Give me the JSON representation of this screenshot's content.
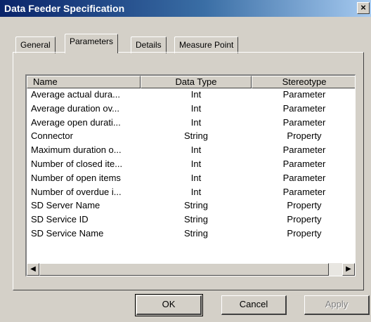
{
  "window": {
    "title": "Data Feeder Specification",
    "close_label": "×"
  },
  "tabs": [
    {
      "label": "General",
      "active": false
    },
    {
      "label": "Parameters",
      "active": true
    },
    {
      "label": "Details",
      "active": false
    },
    {
      "label": "Measure Point",
      "active": false
    }
  ],
  "table": {
    "columns": [
      "Name",
      "Data Type",
      "Stereotype"
    ],
    "rows": [
      [
        "Average actual dura...",
        "Int",
        "Parameter"
      ],
      [
        "Average duration ov...",
        "Int",
        "Parameter"
      ],
      [
        "Average open durati...",
        "Int",
        "Parameter"
      ],
      [
        "Connector",
        "String",
        "Property"
      ],
      [
        "Maximum duration o...",
        "Int",
        "Parameter"
      ],
      [
        "Number of closed ite...",
        "Int",
        "Parameter"
      ],
      [
        "Number of open items",
        "Int",
        "Parameter"
      ],
      [
        "Number of overdue i...",
        "Int",
        "Parameter"
      ],
      [
        "SD Server Name",
        "String",
        "Property"
      ],
      [
        "SD Service ID",
        "String",
        "Property"
      ],
      [
        "SD Service Name",
        "String",
        "Property"
      ]
    ]
  },
  "scrollbar": {
    "left_arrow": "◀",
    "right_arrow": "▶"
  },
  "buttons": {
    "ok": "OK",
    "cancel": "Cancel",
    "apply": "Apply"
  }
}
